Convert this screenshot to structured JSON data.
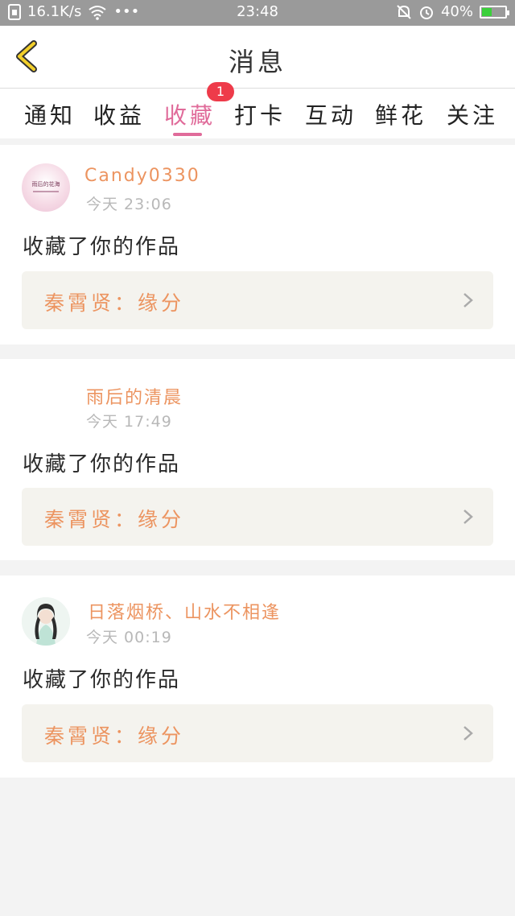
{
  "status_bar": {
    "speed": "16.1K/s",
    "time": "23:48",
    "battery": "40%",
    "battery_level": 0.4
  },
  "header": {
    "title": "消息"
  },
  "tabs": [
    {
      "label": "通知"
    },
    {
      "label": "收益"
    },
    {
      "label": "收藏",
      "active": true,
      "badge": "1"
    },
    {
      "label": "打卡"
    },
    {
      "label": "互动"
    },
    {
      "label": "鲜花"
    },
    {
      "label": "关注"
    }
  ],
  "messages": [
    {
      "user": "Candy0330",
      "time": "今天 23:06",
      "action": "收藏了你的作品",
      "work": "秦霄贤：缘分",
      "avatar_text": "雨后的花海"
    },
    {
      "user": "雨后的清晨",
      "time": "今天 17:49",
      "action": "收藏了你的作品",
      "work": "秦霄贤：缘分"
    },
    {
      "user": "日落烟桥、山水不相逢",
      "time": "今天 00:19",
      "action": "收藏了你的作品",
      "work": "秦霄贤：缘分"
    }
  ],
  "colors": {
    "accent": "#e06b9a",
    "username": "#ec9460",
    "badge": "#ee3b4a",
    "back_icon": "#f2cf2a"
  }
}
